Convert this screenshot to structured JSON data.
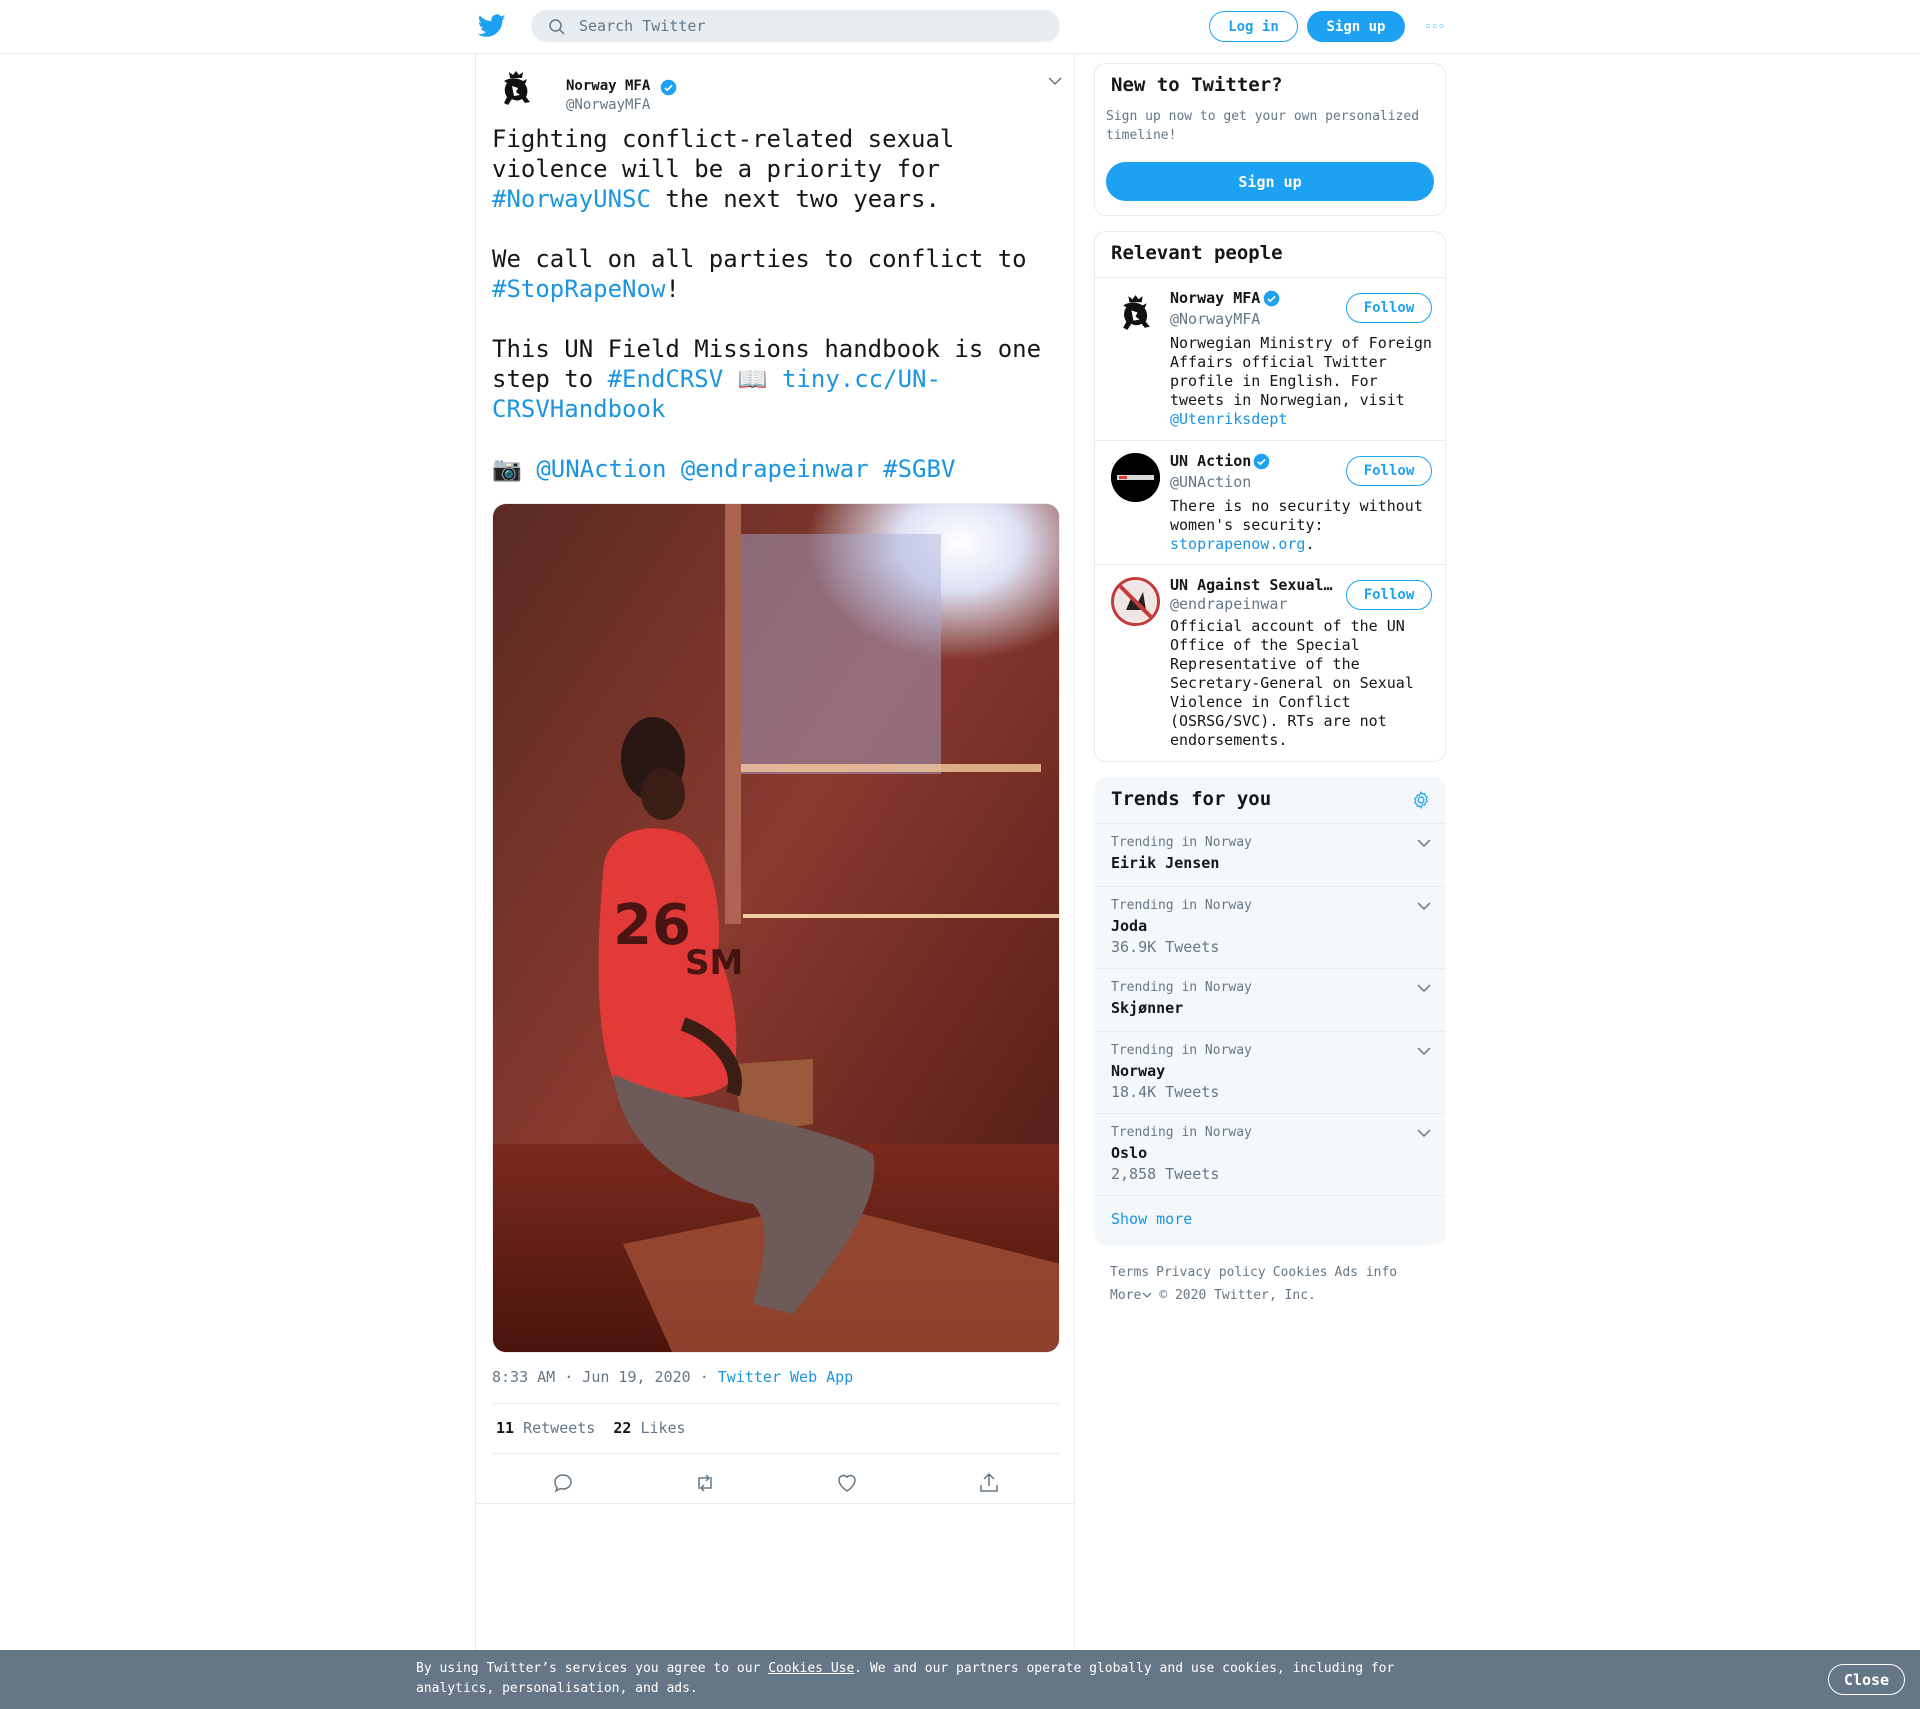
{
  "topbar": {
    "search_placeholder": "Search Twitter",
    "login_label": "Log in",
    "signup_label": "Sign up",
    "more_label": "◦◦◦"
  },
  "tweet": {
    "author_name": "Norway MFA",
    "author_handle": "@NorwayMFA",
    "p1_a": "Fighting conflict-related sexual violence will be a priority for ",
    "p1_tag": "#NorwayUNSC",
    "p1_b": " the next two years.",
    "p2_a": "We call on all parties to conflict to ",
    "p2_tag": "#StopRapeNow",
    "p2_b": "!",
    "p3_a": "This UN Field Missions handbook is one step to ",
    "p3_tag": "#EndCRSV",
    "p3_emoji": " 📖 ",
    "p3_link": "tiny.cc/UN-CRSVHandbook",
    "p4_emoji": "📷 ",
    "p4_m1": "@UNAction",
    "p4_m2": "@endrapeinwar",
    "p4_tag": "#SGBV",
    "time": "8:33 AM · Jun 19, 2020",
    "sep": " · ",
    "source": "Twitter Web App",
    "retweets_count": "11",
    "retweets_label": "Retweets",
    "likes_count": "22",
    "likes_label": "Likes"
  },
  "signup_card": {
    "title": "New to Twitter?",
    "desc": "Sign up now to get your own personalized timeline!",
    "button": "Sign up"
  },
  "relevant": {
    "title": "Relevant people",
    "follow_label": "Follow",
    "people": [
      {
        "name": "Norway MFA",
        "handle": "@NorwayMFA",
        "bio": "Norwegian Ministry of Foreign Affairs official Twitter profile in English. For tweets in Norwegian, visit ",
        "bio_link": "@Utenriksdept"
      },
      {
        "name": "UN Action",
        "handle": "@UNAction",
        "bio": "There is no security without women's security: ",
        "bio_link": "stoprapenow.org",
        "bio_end": "."
      },
      {
        "name": "UN Against Sexual…",
        "handle": "@endrapeinwar",
        "bio": "Official account of the UN Office of the Special Representative of the Secretary-General on Sexual Violence in Conflict (OSRSG/SVC). RTs are not endorsements."
      }
    ]
  },
  "trends": {
    "title": "Trends for you",
    "items": [
      {
        "context": "Trending in Norway",
        "name": "Eirik Jensen",
        "count": ""
      },
      {
        "context": "Trending in Norway",
        "name": "Joda",
        "count": "36.9K Tweets"
      },
      {
        "context": "Trending in Norway",
        "name": "Skjønner",
        "count": ""
      },
      {
        "context": "Trending in Norway",
        "name": "Norway",
        "count": "18.4K Tweets"
      },
      {
        "context": "Trending in Norway",
        "name": "Oslo",
        "count": "2,858 Tweets"
      }
    ],
    "show_more": "Show more"
  },
  "footer": {
    "terms": "Terms",
    "privacy": "Privacy policy",
    "cookies": "Cookies",
    "ads": "Ads info",
    "more": "More",
    "copyright": "© 2020 Twitter, Inc."
  },
  "cookie": {
    "text_a": "By using Twitter’s services you agree to our ",
    "link": "Cookies Use",
    "text_b": ". We and our partners operate globally and use cookies, including for analytics, personalisation, and ads.",
    "close": "Close"
  },
  "colors": {
    "brand": "#1da1f2",
    "link": "#1b95e0",
    "muted": "#657786",
    "banner": "#657786"
  },
  "icons": {
    "logo": "twitter-bird-icon",
    "search": "search-icon",
    "verified": "verified-badge-icon",
    "reply": "reply-icon",
    "retweet": "retweet-icon",
    "like": "heart-icon",
    "share": "share-icon",
    "settings": "gear-icon"
  }
}
